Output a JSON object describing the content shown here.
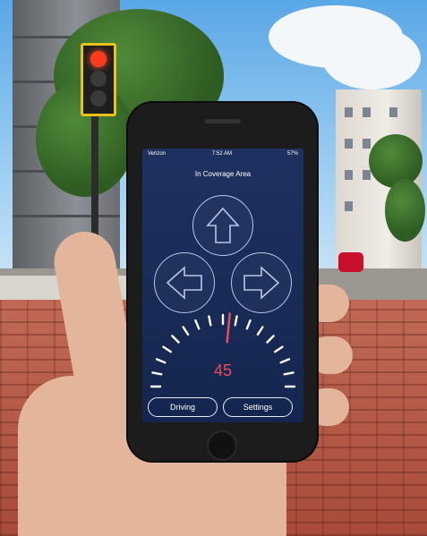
{
  "app": {
    "status_bar": {
      "carrier": "Verizon",
      "time": "7:52 AM",
      "battery": "57%"
    },
    "coverage_status": "In Coverage Area",
    "arrows": {
      "up": "arrow-up-icon",
      "left": "arrow-left-icon",
      "right": "arrow-right-icon"
    },
    "speed": {
      "value": "45"
    },
    "buttons": {
      "driving": "Driving",
      "settings": "Settings"
    }
  },
  "scene": {
    "traffic_light_active": "red",
    "colors": {
      "screen_bg": "#1a2d5c",
      "speed_red": "#ea4d5b",
      "outline": "#b9c6e6"
    }
  }
}
